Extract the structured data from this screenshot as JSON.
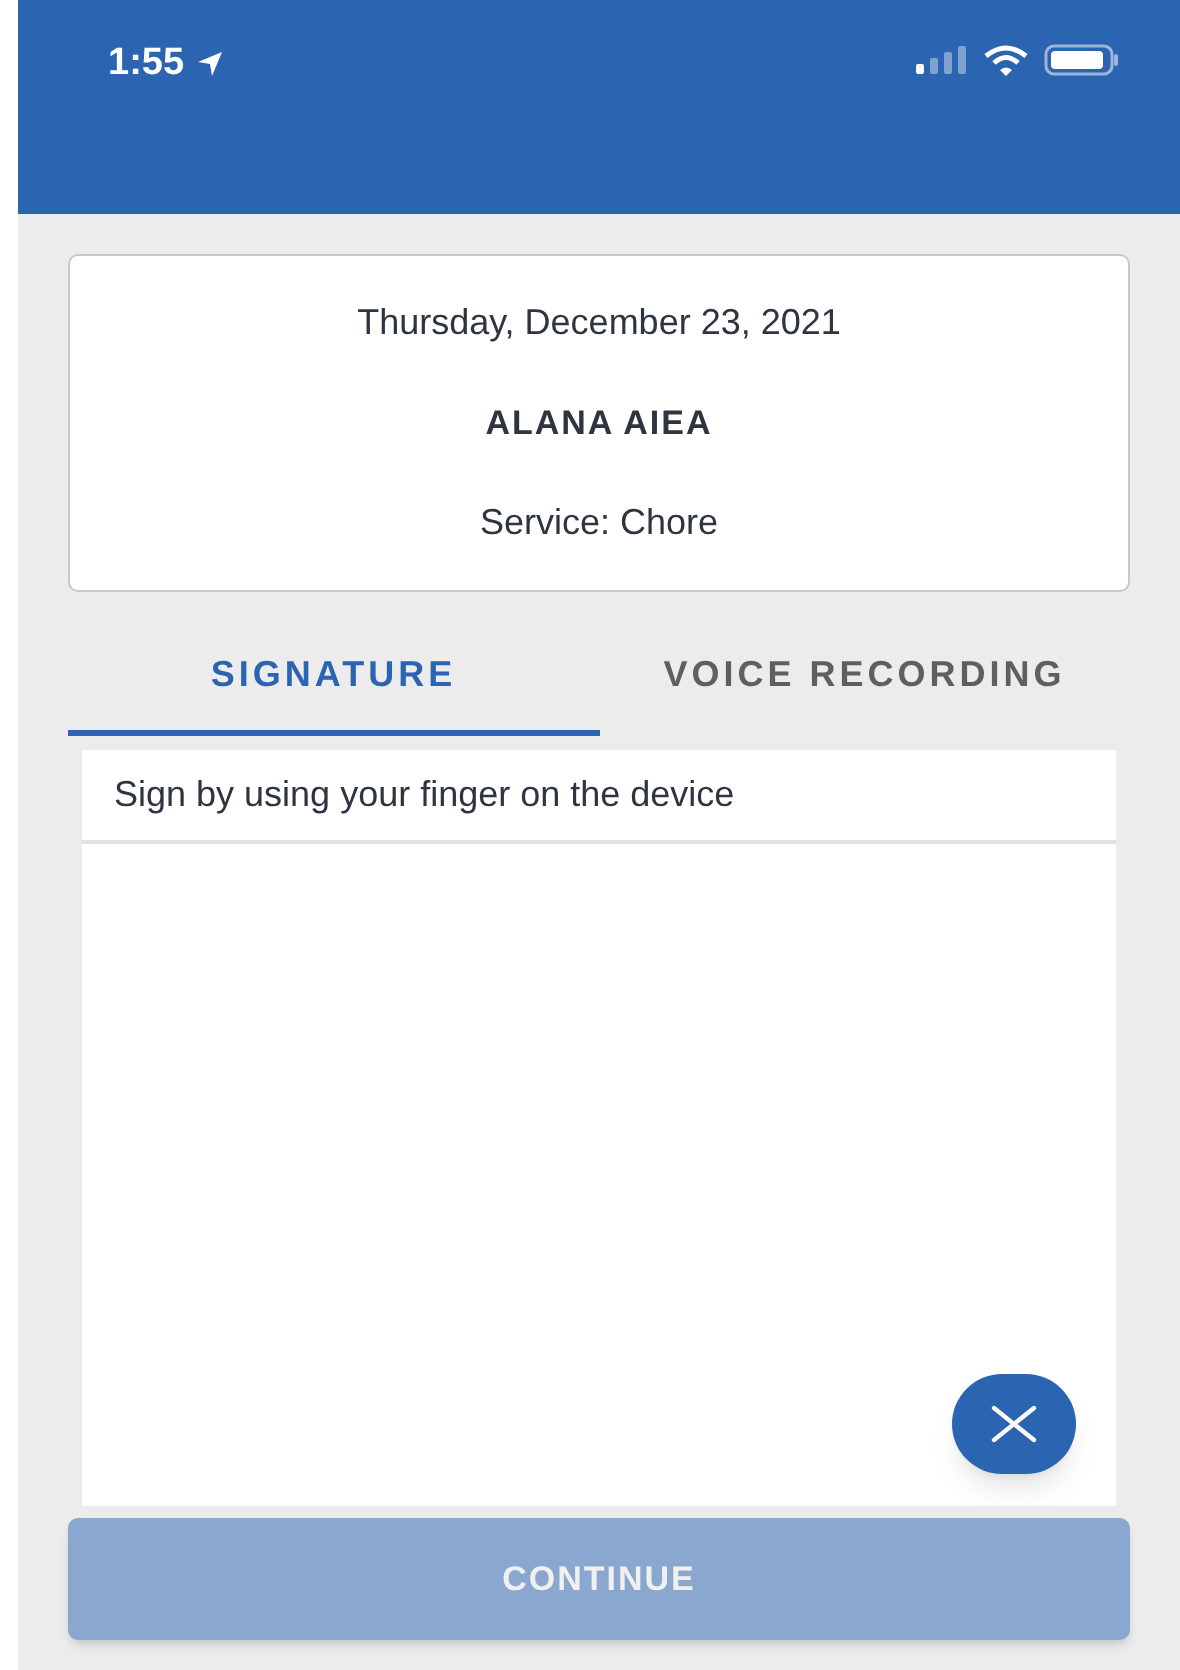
{
  "status_bar": {
    "time": "1:55"
  },
  "visit": {
    "date": "Thursday, December 23, 2021",
    "client": "ALANA AIEA",
    "service": "Service: Chore"
  },
  "tabs": [
    {
      "label": "SIGNATURE",
      "selected": true
    },
    {
      "label": "VOICE RECORDING",
      "selected": false
    }
  ],
  "signature_pad": {
    "instruction": "Sign by using your finger on the device"
  },
  "continue_button": {
    "label": "CONTINUE",
    "disabled": true
  }
}
